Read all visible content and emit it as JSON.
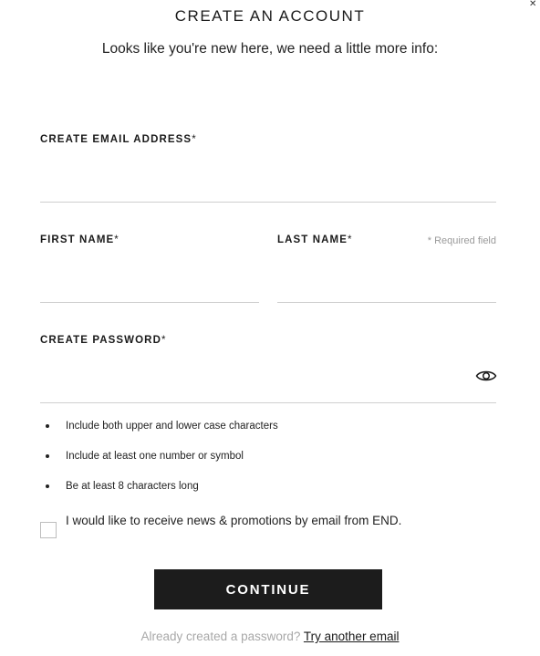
{
  "modal": {
    "title": "CREATE AN ACCOUNT",
    "subtitle": "Looks like you're new here, we need a little more info:"
  },
  "form": {
    "email": {
      "label": "CREATE EMAIL ADDRESS",
      "required_mark": "*",
      "value": "",
      "placeholder": ""
    },
    "first_name": {
      "label": "FIRST NAME",
      "required_mark": "*",
      "value": "",
      "placeholder": ""
    },
    "last_name": {
      "label": "LAST NAME",
      "required_mark": "*",
      "value": "",
      "placeholder": ""
    },
    "required_note": "* Required field",
    "password": {
      "label": "CREATE PASSWORD",
      "required_mark": "*",
      "value": "",
      "placeholder": "",
      "toggle_icon": "eye-icon"
    },
    "password_rules": [
      "Include both upper and lower case characters",
      "Include at least one number or symbol",
      "Be at least 8 characters long"
    ],
    "newsletter": {
      "checked": false,
      "label": "I would like to receive news & promotions by email from END."
    },
    "continue_label": "CONTINUE"
  },
  "footer": {
    "prompt": "Already created a password?",
    "link": "Try another email"
  }
}
